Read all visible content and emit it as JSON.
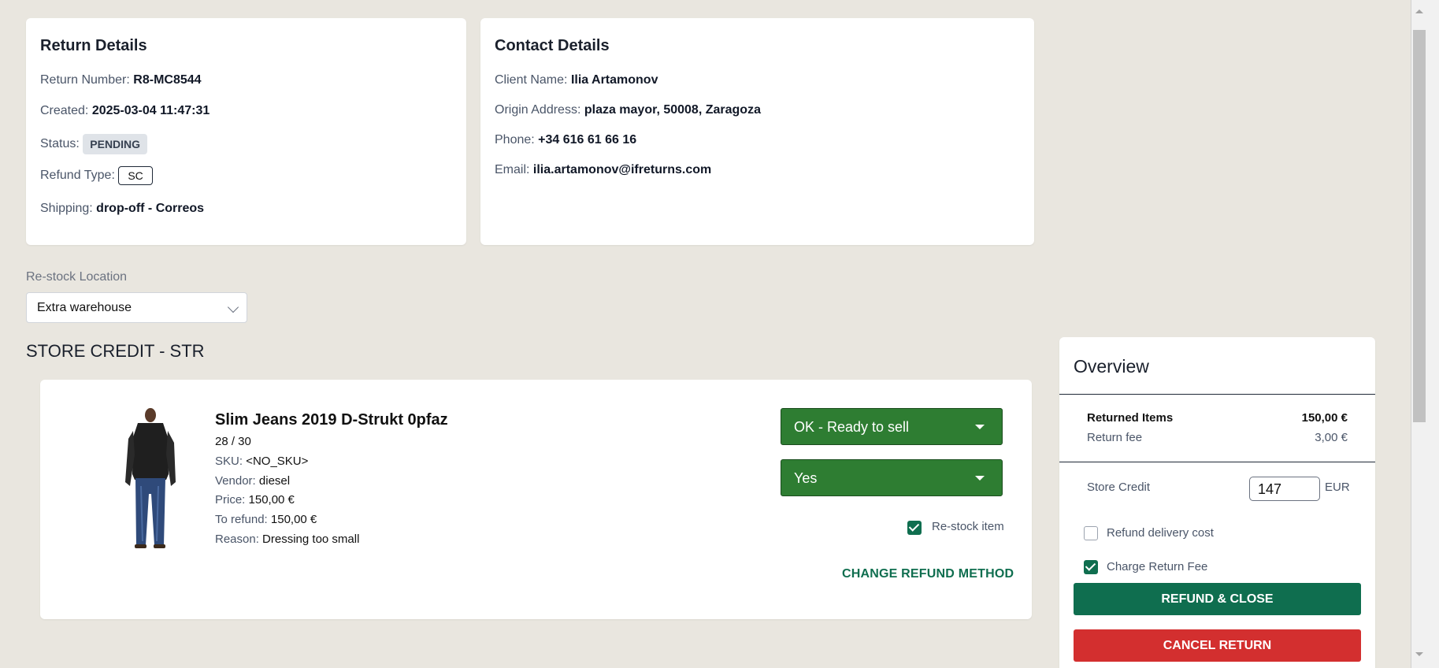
{
  "return_details": {
    "title": "Return Details",
    "number_label": "Return Number:",
    "number_value": "R8-MC8544",
    "created_label": "Created:",
    "created_value": "2025-03-04 11:47:31",
    "status_label": "Status:",
    "status_value": "PENDING",
    "refund_type_label": "Refund Type:",
    "refund_type_value": "SC",
    "shipping_label": "Shipping:",
    "shipping_value": "drop-off - Correos"
  },
  "contact_details": {
    "title": "Contact Details",
    "client_label": "Client Name:",
    "client_value": "Ilia Artamonov",
    "address_label": "Origin Address:",
    "address_value": "plaza mayor, 50008, Zaragoza",
    "phone_label": "Phone:",
    "phone_value": "+34 616 61 66 16",
    "email_label": "Email:",
    "email_value": "ilia.artamonov@ifreturns.com"
  },
  "restock": {
    "label": "Re-stock Location",
    "selected": "Extra warehouse"
  },
  "section_title": "STORE CREDIT - STR",
  "item": {
    "name": "Slim Jeans 2019 D-Strukt 0pfaz",
    "variant": "28 / 30",
    "sku_label": "SKU:",
    "sku_value": "<NO_SKU>",
    "vendor_label": "Vendor:",
    "vendor_value": "diesel",
    "price_label": "Price:",
    "price_value": "150,00 €",
    "refund_label": "To refund:",
    "refund_value": "150,00 €",
    "reason_label": "Reason:",
    "reason_value": "Dressing too small",
    "condition_select": "OK - Ready to sell",
    "yes_select": "Yes",
    "restock_item_label": "Re-stock item",
    "restock_item_checked": true,
    "change_method_label": "CHANGE REFUND METHOD"
  },
  "overview": {
    "title": "Overview",
    "returned_items_label": "Returned Items",
    "returned_items_value": "150,00 €",
    "return_fee_label": "Return fee",
    "return_fee_value": "3,00 €",
    "store_credit_label": "Store Credit",
    "store_credit_value": "147",
    "currency": "EUR",
    "refund_delivery_label": "Refund delivery cost",
    "refund_delivery_checked": false,
    "charge_fee_label": "Charge Return Fee",
    "charge_fee_checked": true,
    "refund_close_label": "REFUND & CLOSE",
    "cancel_label": "CANCEL RETURN"
  },
  "colors": {
    "primary_green": "#0f6e4f",
    "select_green": "#2e7d32",
    "danger_red": "#d32f2f",
    "background": "#e9e6df"
  }
}
